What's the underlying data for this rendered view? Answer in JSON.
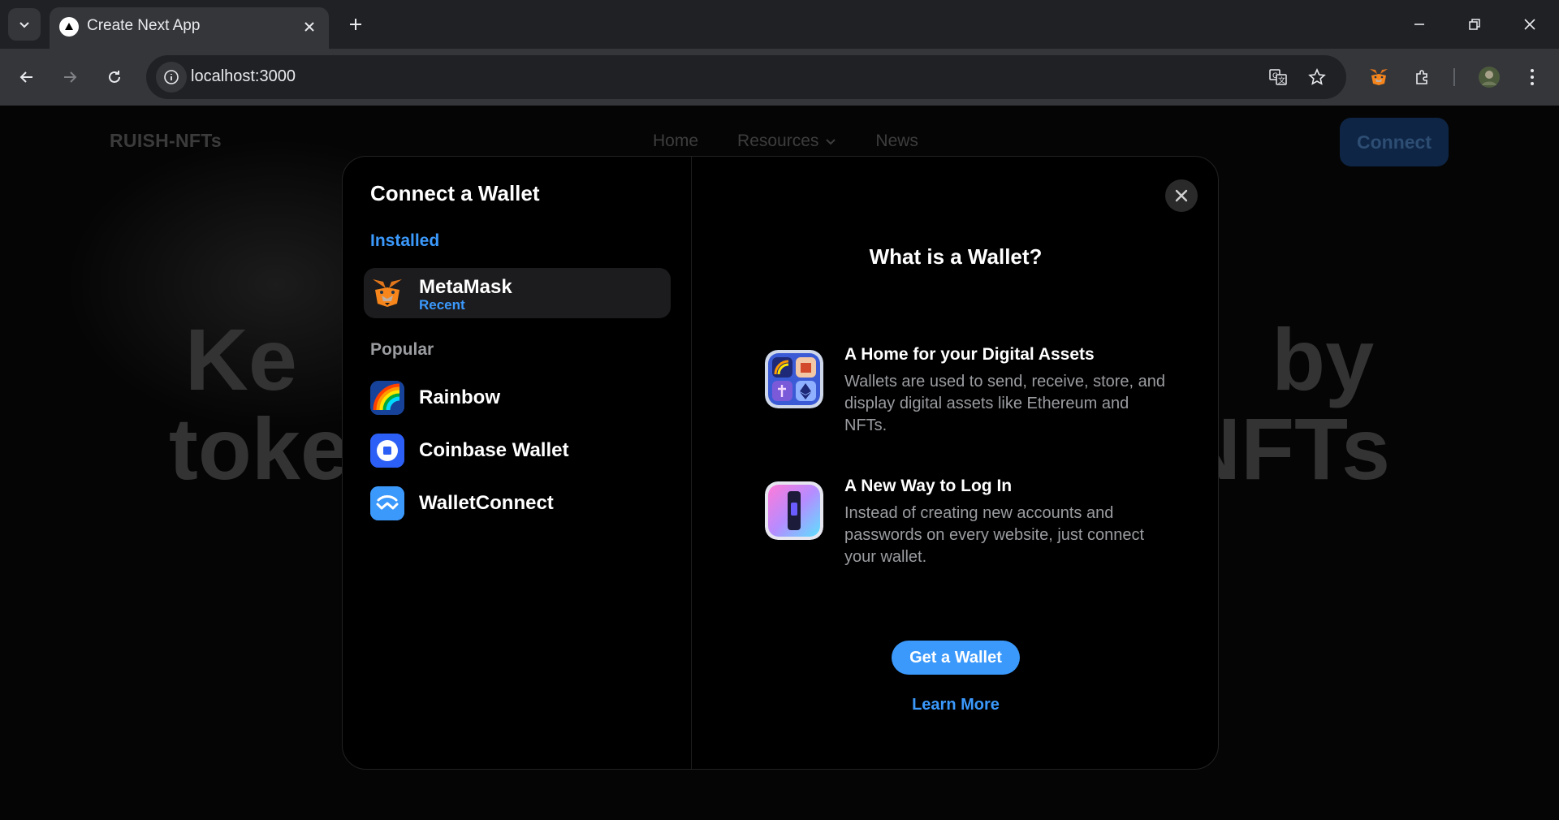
{
  "browser": {
    "tab_title": "Create Next App",
    "url": "localhost:3000"
  },
  "site": {
    "brand": "RUISH-NFTs",
    "nav": [
      "Home",
      "Resources",
      "News"
    ],
    "connect_label": "Connect",
    "hero_line1": "Ke                                        by",
    "hero_line2": "toke                                  NFTs"
  },
  "modal": {
    "title": "Connect a Wallet",
    "installed_label": "Installed",
    "installed": [
      {
        "name": "MetaMask",
        "sub": "Recent"
      }
    ],
    "popular_label": "Popular",
    "popular": [
      {
        "name": "Rainbow"
      },
      {
        "name": "Coinbase Wallet"
      },
      {
        "name": "WalletConnect"
      }
    ],
    "right_title": "What is a Wallet?",
    "features": [
      {
        "title": "A Home for your Digital Assets",
        "desc": "Wallets are used to send, receive, store, and display digital assets like Ethereum and NFTs."
      },
      {
        "title": "A New Way to Log In",
        "desc": "Instead of creating new accounts and passwords on every website, just connect your wallet."
      }
    ],
    "get_wallet": "Get a Wallet",
    "learn_more": "Learn More"
  },
  "colors": {
    "accent": "#3b99fc",
    "modal_bg": "#000000",
    "chrome_bg": "#202124"
  }
}
